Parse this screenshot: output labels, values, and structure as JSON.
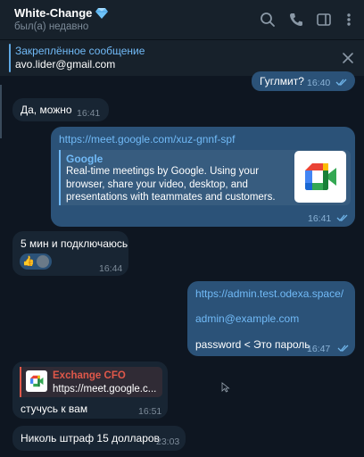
{
  "header": {
    "title": "White-Change",
    "status": "был(а) недавно"
  },
  "pinned": {
    "title": "Закреплённое сообщение",
    "text": "avo.lider@gmail.com"
  },
  "messages": {
    "m1": {
      "text": "Гуглмит?",
      "time": "16:40"
    },
    "m2": {
      "text": "Да, можно",
      "time": "16:41"
    },
    "m3": {
      "url": "https://meet.google.com/xuz-gnnf-spf",
      "preview_site": "Google",
      "preview_line1": "Real-time meetings by Google. Using your",
      "preview_line2": "browser, share your video, desktop, and",
      "preview_line3": "presentations with teammates and customers.",
      "time": "16:41"
    },
    "m4": {
      "text": "5 мин и подключаюсь",
      "reaction": "👍",
      "time": "16:44"
    },
    "m5": {
      "line1": "https://admin.test.odexa.space/",
      "line2": "admin@example.com",
      "line3": "password < Это пароль",
      "time": "16:47"
    },
    "m6": {
      "reply_name": "Exchange CFO",
      "reply_text": "https://meet.google.c...",
      "text": "стучусь к вам",
      "time": "16:51"
    },
    "m7": {
      "text": "Николь штраф 15 долларов",
      "time": "23:03"
    }
  },
  "colors": {
    "bg": "#0e1621",
    "header": "#17212b",
    "incoming": "#182533",
    "outgoing": "#2b5278",
    "link": "#71baf7",
    "exchange_name": "#e0584a"
  }
}
